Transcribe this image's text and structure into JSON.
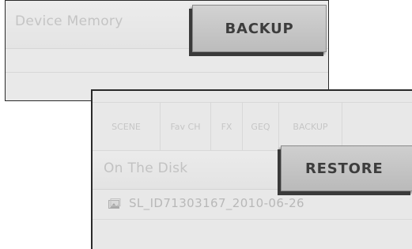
{
  "device_panel": {
    "label": "Device Memory",
    "backup_label": "BACKUP"
  },
  "disk_panel": {
    "tabs": [
      {
        "label": "SCENE"
      },
      {
        "label": "Fav CH"
      },
      {
        "label": "FX"
      },
      {
        "label": "GEQ"
      },
      {
        "label": "BACKUP"
      }
    ],
    "label": "On The Disk",
    "restore_label": "RESTORE",
    "files": [
      {
        "name": "SL_ID71303167_2010-06-26",
        "icon": "file-icon"
      }
    ]
  }
}
